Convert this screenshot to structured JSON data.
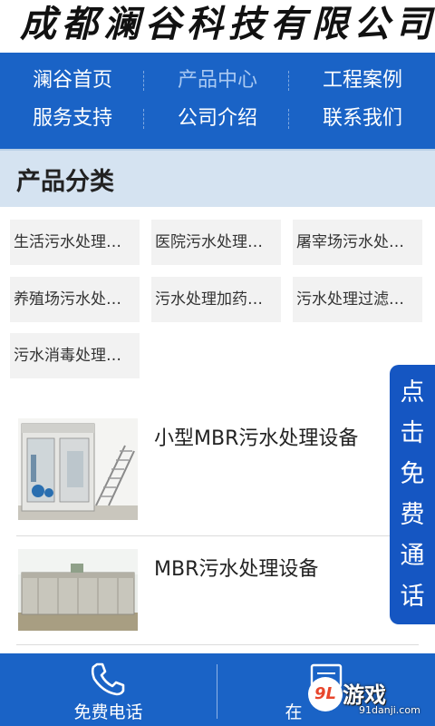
{
  "header": {
    "company_name": "成都澜谷科技有限公司"
  },
  "nav": {
    "items": [
      {
        "label": "澜谷首页",
        "active": false
      },
      {
        "label": "产品中心",
        "active": true
      },
      {
        "label": "工程案例",
        "active": false
      },
      {
        "label": "服务支持",
        "active": false
      },
      {
        "label": "公司介绍",
        "active": false
      },
      {
        "label": "联系我们",
        "active": false
      }
    ]
  },
  "categories": {
    "title": "产品分类",
    "items": [
      "生活污水处理…",
      "医院污水处理…",
      "屠宰场污水处…",
      "养殖场污水处…",
      "污水处理加药…",
      "污水处理过滤…",
      "污水消毒处理…"
    ]
  },
  "products": [
    {
      "name": "小型MBR污水处理设备",
      "thumb_icon": "container-equipment-photo"
    },
    {
      "name": "MBR污水处理设备",
      "thumb_icon": "concrete-tank-photo"
    }
  ],
  "floating_call": {
    "label": "点击免费通话"
  },
  "bottom_bar": {
    "call_label": "免费电话",
    "call_icon": "phone-icon",
    "second_label": "在",
    "second_icon": "message-icon"
  },
  "watermark": {
    "logo_text": "游戏",
    "badge_text": "9L",
    "site": "91danji.com"
  },
  "colors": {
    "brand_blue": "#1a63c6",
    "category_bar": "#d5e3f1",
    "float_blue": "#1556c2"
  }
}
